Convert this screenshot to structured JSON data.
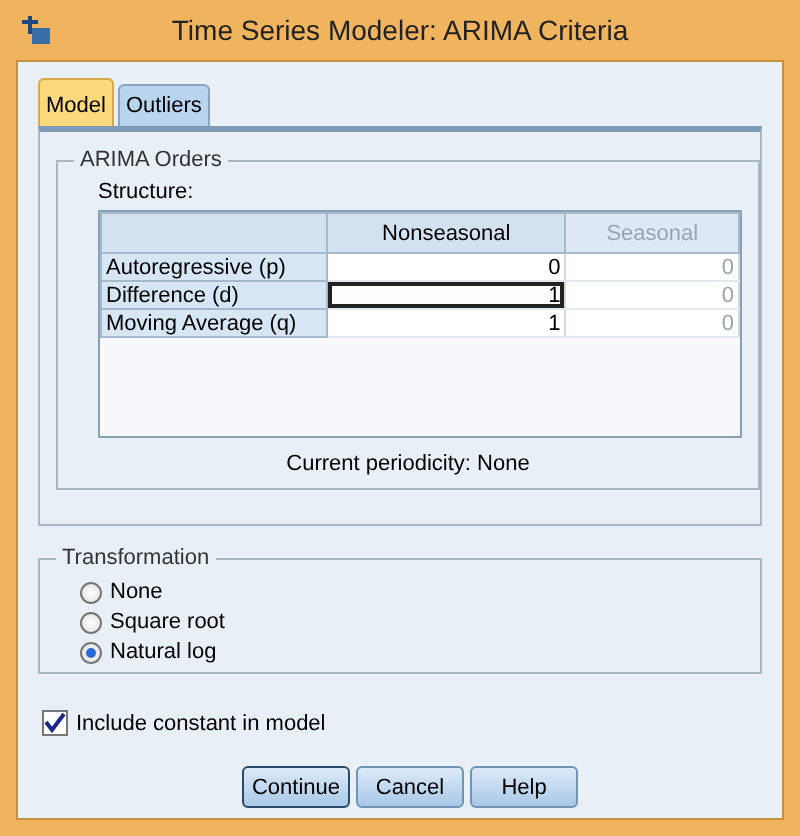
{
  "window": {
    "title": "Time Series Modeler: ARIMA Criteria"
  },
  "tabs": [
    {
      "label": "Model",
      "selected": true
    },
    {
      "label": "Outliers",
      "selected": false
    }
  ],
  "arima_orders": {
    "title": "ARIMA Orders",
    "structure_label": "Structure:",
    "columns": [
      {
        "label": "Nonseasonal",
        "disabled": false
      },
      {
        "label": "Seasonal",
        "disabled": true
      }
    ],
    "rows": [
      {
        "label": "Autoregressive (p)",
        "values": [
          "0",
          "0"
        ],
        "focused": false
      },
      {
        "label": "Difference (d)",
        "values": [
          "1",
          "0"
        ],
        "focused": true
      },
      {
        "label": "Moving Average (q)",
        "values": [
          "1",
          "0"
        ],
        "focused": false
      }
    ],
    "periodicity": "Current periodicity: None"
  },
  "transformation": {
    "title": "Transformation",
    "options": [
      {
        "label": "None",
        "selected": false
      },
      {
        "label": "Square root",
        "selected": false
      },
      {
        "label": "Natural log",
        "selected": true
      }
    ]
  },
  "include_constant": {
    "label": "Include constant in model",
    "checked": true
  },
  "buttons": [
    {
      "label": "Continue",
      "default": true
    },
    {
      "label": "Cancel",
      "default": false
    },
    {
      "label": "Help",
      "default": false
    }
  ]
}
